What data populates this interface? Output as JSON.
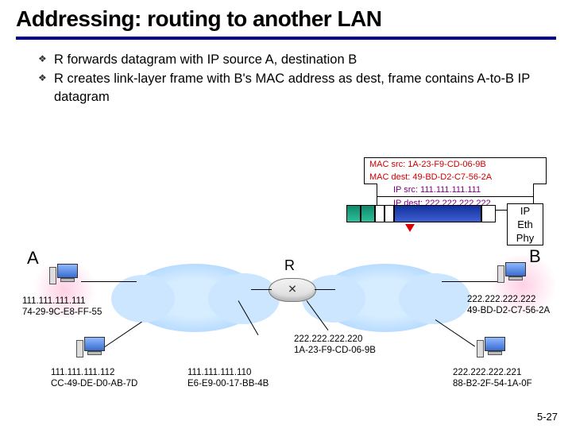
{
  "title": "Addressing: routing to another LAN",
  "bullets": [
    "R forwards datagram with IP source A, destination B",
    "R creates link-layer frame with B's MAC address as dest, frame contains A-to-B IP datagram"
  ],
  "frame_header": {
    "mac_src_label": "MAC src:",
    "mac_src": "1A-23-F9-CD-06-9B",
    "mac_dest_label": "MAC dest:",
    "mac_dest": "49-BD-D2-C7-56-2A",
    "ip_src_label": "IP src:",
    "ip_src": "111.111.111.111",
    "ip_dest_label": "IP dest:",
    "ip_dest": "222.222.222.222"
  },
  "layer_stack": [
    "IP",
    "Eth",
    "Phy"
  ],
  "hosts": {
    "A": {
      "label": "A",
      "ip": "111.111.111.111",
      "mac": "74-29-9C-E8-FF-55"
    },
    "A2": {
      "ip": "111.111.111.112",
      "mac": "CC-49-DE-D0-AB-7D"
    },
    "Rleft": {
      "ip": "111.111.111.110",
      "mac": "E6-E9-00-17-BB-4B"
    },
    "Rright": {
      "ip": "222.222.222.220",
      "mac": "1A-23-F9-CD-06-9B"
    },
    "B": {
      "label": "B",
      "ip": "222.222.222.222",
      "mac": "49-BD-D2-C7-56-2A"
    },
    "B2": {
      "ip": "222.222.222.221",
      "mac": "88-B2-2F-54-1A-0F"
    }
  },
  "router_label": "R",
  "slide_number": "5-27"
}
